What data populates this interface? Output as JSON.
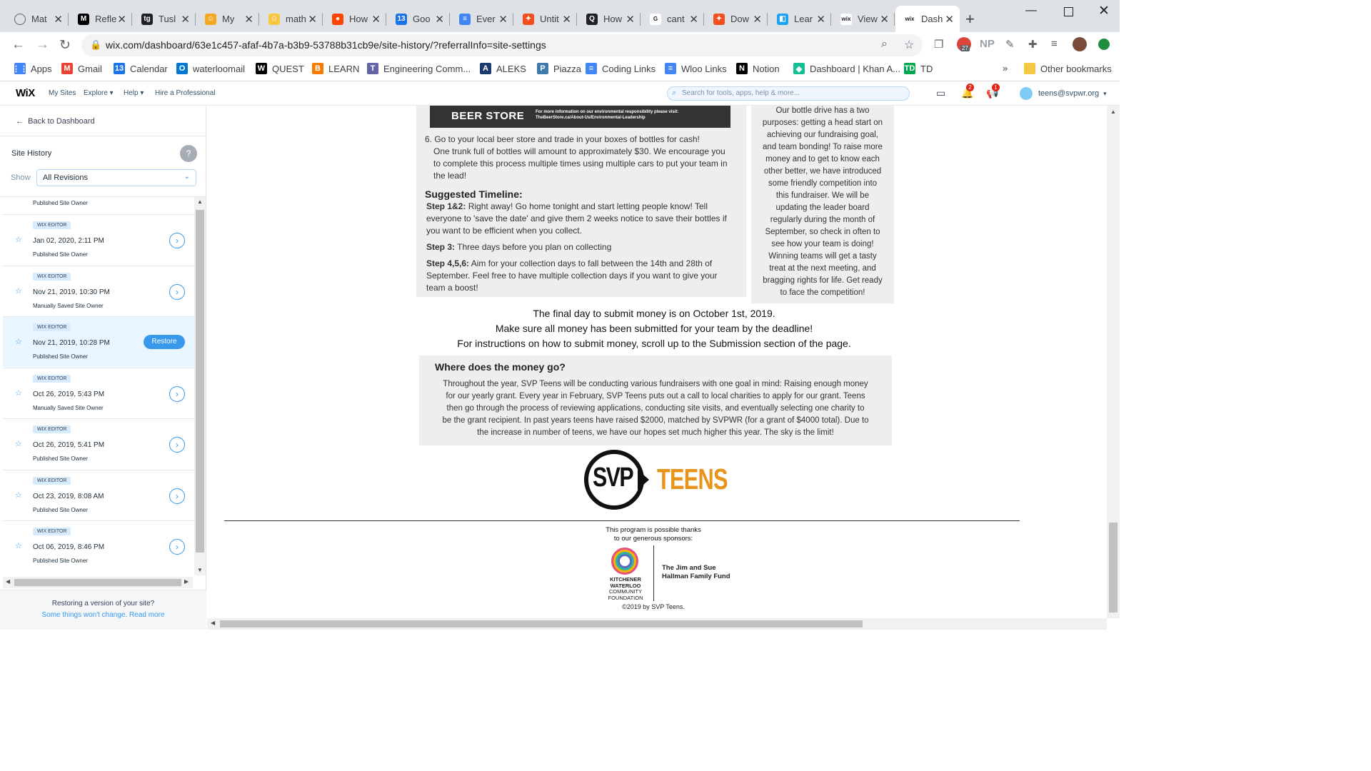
{
  "browser": {
    "tabs": [
      {
        "label": "Mat",
        "icon": "globe-icon",
        "color": "#5f6368"
      },
      {
        "label": "Refle",
        "icon": "medium-icon",
        "color": "#000000",
        "glyph": "M"
      },
      {
        "label": "Tusl",
        "icon": "tg-icon",
        "color": "#202124",
        "glyph": "tg"
      },
      {
        "label": "My",
        "icon": "myfav-icon",
        "color": "#f6a821",
        "glyph": "☺"
      },
      {
        "label": "math",
        "icon": "smiley-icon",
        "color": "#f6c744",
        "glyph": "☺"
      },
      {
        "label": "How",
        "icon": "reddit-icon",
        "color": "#ff4500",
        "glyph": "●"
      },
      {
        "label": "Goo",
        "icon": "calendar-icon",
        "color": "#1a73e8",
        "glyph": "13"
      },
      {
        "label": "Ever",
        "icon": "docs-icon",
        "color": "#4285f4",
        "glyph": "≡"
      },
      {
        "label": "Untit",
        "icon": "figma-icon",
        "color": "#f24e1e",
        "glyph": "✦"
      },
      {
        "label": "How",
        "icon": "quizlet-icon",
        "color": "#202124",
        "glyph": "Q"
      },
      {
        "label": "cant",
        "icon": "google-icon",
        "color": "#ffffff",
        "glyph": "G"
      },
      {
        "label": "Dow",
        "icon": "figma-icon",
        "color": "#f24e1e",
        "glyph": "✦"
      },
      {
        "label": "Lear",
        "icon": "learn-icon",
        "color": "#1da1f2",
        "glyph": "◧"
      },
      {
        "label": "View",
        "icon": "wix-icon",
        "color": "#ffffff",
        "glyph": "wix"
      },
      {
        "label": "Dash",
        "icon": "wix-icon",
        "color": "#ffffff",
        "glyph": "wix",
        "active": true
      }
    ],
    "url": "wix.com/dashboard/63e1c457-afaf-4b7a-b3b9-53788b31cb9e/site-history/?referralInfo=site-settings",
    "profile_text": "NP",
    "ext_badge": "27",
    "bookmarks": [
      {
        "label": "Apps",
        "icon": "apps-icon",
        "color": "#4285f4",
        "glyph": "⋮⋮"
      },
      {
        "label": "Gmail",
        "icon": "gmail-icon",
        "color": "#ea4335",
        "glyph": "M"
      },
      {
        "label": "Calendar",
        "icon": "calendar-icon",
        "color": "#1a73e8",
        "glyph": "13"
      },
      {
        "label": "waterloomail",
        "icon": "outlook-icon",
        "color": "#0078d4",
        "glyph": "O"
      },
      {
        "label": "QUEST",
        "icon": "quest-icon",
        "color": "#000000",
        "glyph": "W"
      },
      {
        "label": "LEARN",
        "icon": "learn-d2l-icon",
        "color": "#f57c00",
        "glyph": "B"
      },
      {
        "label": "Engineering Comm...",
        "icon": "teams-icon",
        "color": "#6264a7",
        "glyph": "T"
      },
      {
        "label": "ALEKS",
        "icon": "aleks-icon",
        "color": "#1d3a6e",
        "glyph": "A"
      },
      {
        "label": "Piazza",
        "icon": "piazza-icon",
        "color": "#3e7aab",
        "glyph": "P"
      },
      {
        "label": "Coding Links",
        "icon": "docs-icon",
        "color": "#4285f4",
        "glyph": "≡"
      },
      {
        "label": "Wloo Links",
        "icon": "docs-icon",
        "color": "#4285f4",
        "glyph": "≡"
      },
      {
        "label": "Notion",
        "icon": "notion-icon",
        "color": "#000000",
        "glyph": "N"
      },
      {
        "label": "Dashboard | Khan A...",
        "icon": "khan-icon",
        "color": "#14bf96",
        "glyph": "◆"
      },
      {
        "label": "TD",
        "icon": "td-icon",
        "color": "#00a651",
        "glyph": "TD"
      }
    ],
    "other_bookmarks": "Other bookmarks"
  },
  "wix": {
    "logo": "WiX",
    "nav": [
      "My Sites",
      "Explore",
      "Help",
      "Hire a Professional"
    ],
    "search_placeholder": "Search for tools, apps, help & more...",
    "notif_count": "2",
    "updates_count": "1",
    "user_email": "teens@svpwr.org"
  },
  "sidebar": {
    "back_label": "Back to Dashboard",
    "title": "Site History",
    "help": "?",
    "show_label": "Show",
    "filter_value": "All Revisions",
    "top_partial": "Published Site Owner",
    "revisions": [
      {
        "tag": "WIX EDITOR",
        "date": "Jan 02, 2020, 2:11 PM",
        "sub": "Published Site Owner"
      },
      {
        "tag": "WIX EDITOR",
        "date": "Nov 21, 2019, 10:30 PM",
        "sub": "Manually Saved Site Owner"
      },
      {
        "tag": "WIX EDITOR",
        "date": "Nov 21, 2019, 10:28 PM",
        "sub": "Published Site Owner",
        "selected": true
      },
      {
        "tag": "WIX EDITOR",
        "date": "Oct 26, 2019, 5:43 PM",
        "sub": "Manually Saved Site Owner"
      },
      {
        "tag": "WIX EDITOR",
        "date": "Oct 26, 2019, 5:41 PM",
        "sub": "Published Site Owner"
      },
      {
        "tag": "WIX EDITOR",
        "date": "Oct 23, 2019, 8:08 AM",
        "sub": "Published Site Owner"
      },
      {
        "tag": "WIX EDITOR",
        "date": "Oct 06, 2019, 8:46 PM",
        "sub": "Published Site Owner"
      }
    ],
    "restore_label": "Restore",
    "footer_line1": "Restoring a version of your site?",
    "footer_line2": "Some things won't change. Read more"
  },
  "site": {
    "beer_store": "BEER STORE",
    "beer_info_1": "For more information on our environmental responsibility please visit:",
    "beer_info_2": "TheBeerStore.ca/About-Us/Environmental-Leadership",
    "step6_line1": "6. Go to your local beer store and trade in your boxes of bottles for cash!",
    "step6_line2": "One trunk full of bottles will amount to approximately $30. We encourage you",
    "step6_line3": "to complete this process multiple times using multiple cars to put your team in",
    "step6_line4": "the lead!",
    "timeline_title": "Suggested Timeline:",
    "t1_label": "Step 1&2:",
    "t1_line1": " Right away! Go home tonight and start letting people know! Tell",
    "t1_line2": "everyone to 'save the date' and give them 2 weeks notice to save their bottles if",
    "t1_line3": "you want to be efficient when you collect.",
    "t2_label": "Step 3:",
    "t2_line1": " Three days before you plan on collecting",
    "t3_label": "Step 4,5,6:",
    "t3_line1": " Aim for your collection days to fall between the 14th and 28th of",
    "t3_line2": "September. Feel free to have multiple collection days if you want to give your",
    "t3_line3": "team a boost!",
    "right_box": [
      "Our bottle drive has a two",
      "purposes: getting a head start on",
      "achieving our fundraising goal,",
      "and team bonding! To raise more",
      "money and to get to know each",
      "other better, we have introduced",
      "some friendly competition into",
      "this fundraiser. We will be",
      "updating the leader board",
      "regularly during the month of",
      "September, so check in often to",
      "see how your team is doing!",
      "Winning teams will get a tasty",
      "treat at the next meeting, and",
      "bragging rights for life. Get ready",
      "to face the competition!"
    ],
    "final_line1": "The final day to submit money is on October 1st, 2019.",
    "final_line2": "Make sure all money has been submitted for your team by the deadline!",
    "final_line3": "For instructions on how to submit money, scroll up to the Submission section of the page.",
    "money_title": "Where does the money go?",
    "money_lines": [
      "Throughout the year, SVP Teens will be conducting various fundraisers with one goal in mind: Raising enough money",
      "for our yearly grant. Every year in February, SVP Teens puts out a call to local charities to apply for our grant. Teens",
      "then go through the process of reviewing applications, conducting site visits, and eventually selecting one charity to",
      "be the grant recipient. In past years teens have raised $2000, matched by SVPWR  (for a grant of $4000 total). Due to",
      "the increase in number of teens, we have our hopes set much higher this year. The sky is the limit!"
    ],
    "logo_svp": "SVP",
    "logo_teens": "TEENS",
    "sponsor_line1": "This program is possible thanks",
    "sponsor_line2": "to our generous sponsors:",
    "kwcf_1": "KITCHENER",
    "kwcf_2": "WATERLOO",
    "kwcf_3": "COMMUNITY",
    "kwcf_4": "FOUNDATION",
    "fund_1": "The Jim and Sue",
    "fund_2": "Hallman Family Fund",
    "copyright": "©2019 by SVP Teens."
  },
  "colors": {
    "accent": "#3899ec",
    "svp_orange": "#e8941a"
  }
}
